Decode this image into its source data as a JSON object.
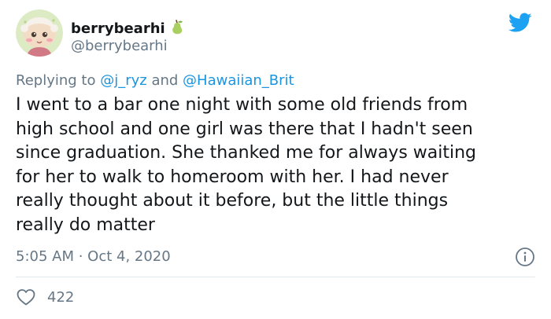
{
  "user": {
    "display_name": "berrybearhi",
    "handle": "@berrybearhi"
  },
  "reply": {
    "prefix": "Replying to ",
    "mention1": "@j_ryz",
    "conjunction": " and ",
    "mention2": "@Hawaiian_Brit"
  },
  "tweet": {
    "text": "I went to a bar one night with some old friends from\nhigh school and one girl was there that I hadn't seen\nsince graduation. She thanked me for always waiting\nfor her to walk to homeroom with her. I had never\nreally thought about it before, but the little things\nreally do matter",
    "timestamp": "5:05 AM · Oct 4, 2020"
  },
  "stats": {
    "likes": "422"
  },
  "icons": {
    "logo": "twitter-bird-icon",
    "name_emoji": "pear-icon",
    "info": "info-icon",
    "like": "heart-icon"
  },
  "colors": {
    "brand": "#1da1f2",
    "link": "#1b95e0",
    "secondary_text": "#657786",
    "primary_text": "#14171a"
  }
}
